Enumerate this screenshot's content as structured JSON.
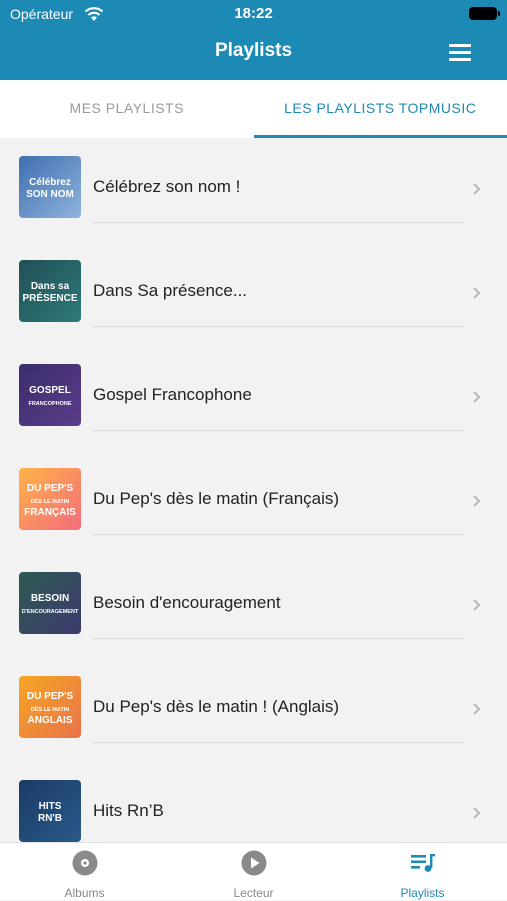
{
  "status": {
    "carrier": "Opérateur",
    "time": "18:22"
  },
  "header": {
    "title": "Playlists"
  },
  "tabs": [
    {
      "label": "MES PLAYLISTS",
      "active": false
    },
    {
      "label": "LES PLAYLISTS TOPMUSIC",
      "active": true
    }
  ],
  "playlists": [
    {
      "title": "Célébrez son nom !",
      "cover_text": [
        "Célébrez",
        "SON NOM"
      ],
      "colors": [
        "#3f6fb0",
        "#8fb3dc"
      ]
    },
    {
      "title": "Dans Sa présence...",
      "cover_text": [
        "Dans sa",
        "PRÉSENCE"
      ],
      "colors": [
        "#1f5056",
        "#2e7a7a"
      ]
    },
    {
      "title": "Gospel Francophone",
      "cover_text": [
        "GOSPEL",
        "FRANCOPHONE"
      ],
      "colors": [
        "#3a2d6b",
        "#5b3d8a"
      ]
    },
    {
      "title": "Du Pep's dès le matin (Français)",
      "cover_text": [
        "DU PEP'S",
        "DÈS LE MATIN",
        "FRANÇAIS"
      ],
      "colors": [
        "#ffb347",
        "#f36c7d"
      ]
    },
    {
      "title": "Besoin d'encouragement",
      "cover_text": [
        "BESOIN",
        "D'ENCOURAGEMENT"
      ],
      "colors": [
        "#2f5a52",
        "#3d3a6e"
      ]
    },
    {
      "title": "Du Pep's dès le matin ! (Anglais)",
      "cover_text": [
        "DU PEP'S",
        "DÈS LE MATIN",
        "ANGLAIS"
      ],
      "colors": [
        "#f6a623",
        "#e8734a"
      ]
    },
    {
      "title": "Hits Rn’B",
      "cover_text": [
        "HITS",
        "RN'B"
      ],
      "colors": [
        "#1b3b66",
        "#2a5a8a"
      ]
    }
  ],
  "tabbar": [
    {
      "label": "Albums",
      "icon": "disc-icon",
      "active": false
    },
    {
      "label": "Lecteur",
      "icon": "play-circle-icon",
      "active": false
    },
    {
      "label": "Playlists",
      "icon": "playlist-icon",
      "active": true
    }
  ],
  "colors": {
    "accent": "#1d8ab5",
    "background": "#f2f2f2"
  }
}
